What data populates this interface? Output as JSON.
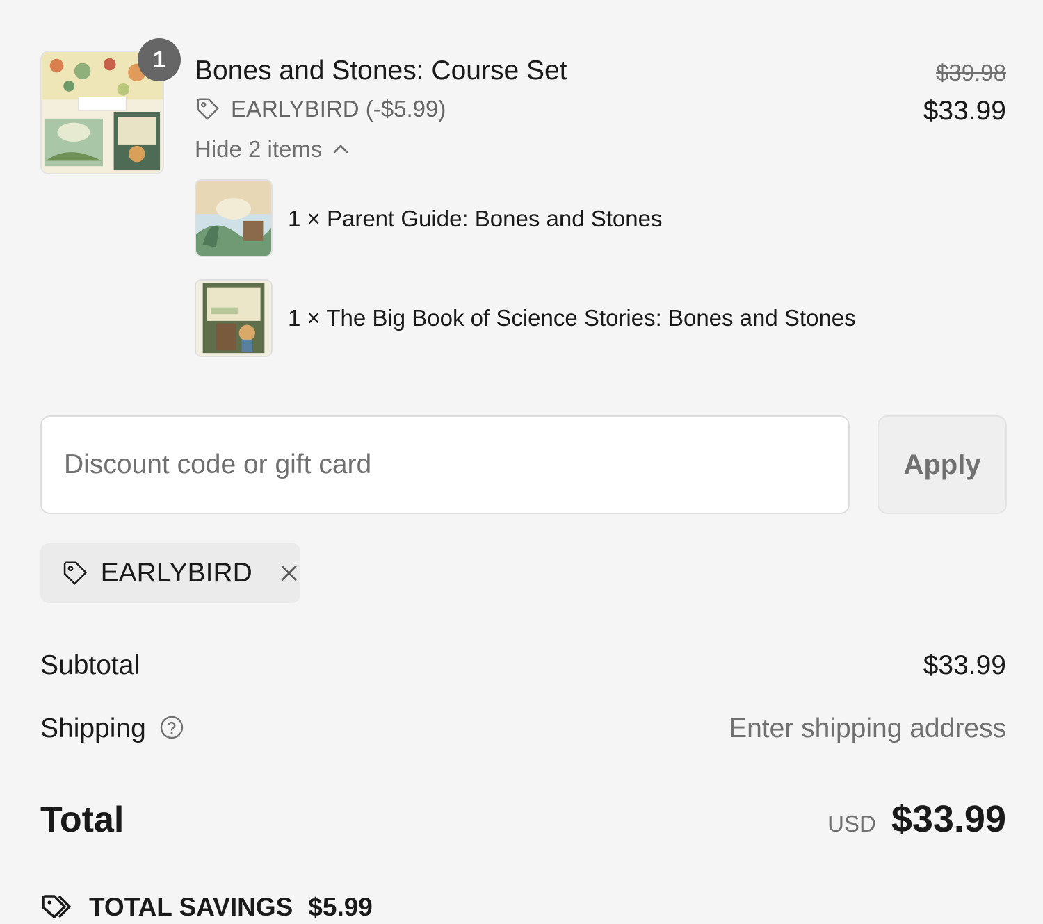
{
  "cart": {
    "quantity_badge": "1",
    "product_title": "Bones and Stones: Course Set",
    "discount_line": "EARLYBIRD (-$5.99)",
    "original_price": "$39.98",
    "discounted_price": "$33.99",
    "toggle_label": "Hide 2 items",
    "bundle_items": [
      {
        "label": "1 × Parent Guide: Bones and Stones"
      },
      {
        "label": "1 × The Big Book of Science Stories: Bones and Stones"
      }
    ]
  },
  "discount": {
    "placeholder": "Discount code or gift card",
    "apply_label": "Apply",
    "applied_code": "EARLYBIRD"
  },
  "summary": {
    "subtotal_label": "Subtotal",
    "subtotal_value": "$33.99",
    "shipping_label": "Shipping",
    "shipping_value": "Enter shipping address",
    "total_label": "Total",
    "currency": "USD",
    "total_value": "$33.99",
    "savings_label": "TOTAL SAVINGS",
    "savings_value": "$5.99"
  },
  "icons": {
    "tag": "tag-icon",
    "chevron": "chevron-up-icon",
    "remove": "close-icon",
    "help": "help-circle-icon",
    "savings": "tags-icon"
  }
}
